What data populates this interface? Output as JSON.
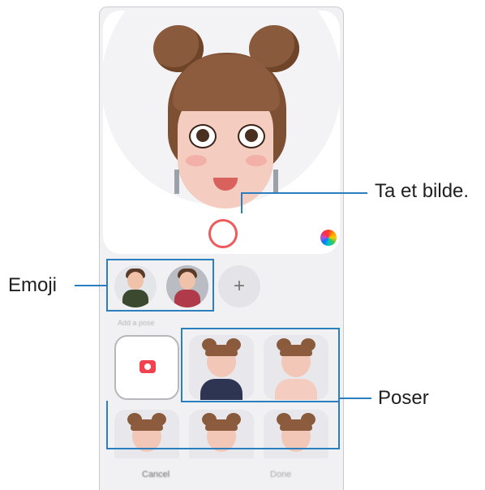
{
  "callouts": {
    "photo": "Ta et bilde.",
    "emoji": "Emoji",
    "poses": "Poser"
  },
  "screen": {
    "add_button_label": "+",
    "section_label": "Add a pose",
    "cancel_label": "Cancel",
    "done_label": "Done"
  },
  "colors": {
    "callout_line": "#2b7fbf",
    "shutter_ring": "#ef5a5a",
    "camera_tile_icon": "#f0434f",
    "screen_background": "#f1f1f3"
  },
  "icons": {
    "shutter": "shutter-button",
    "color": "color-wheel-icon",
    "add": "plus-icon",
    "camera": "camera-icon"
  }
}
